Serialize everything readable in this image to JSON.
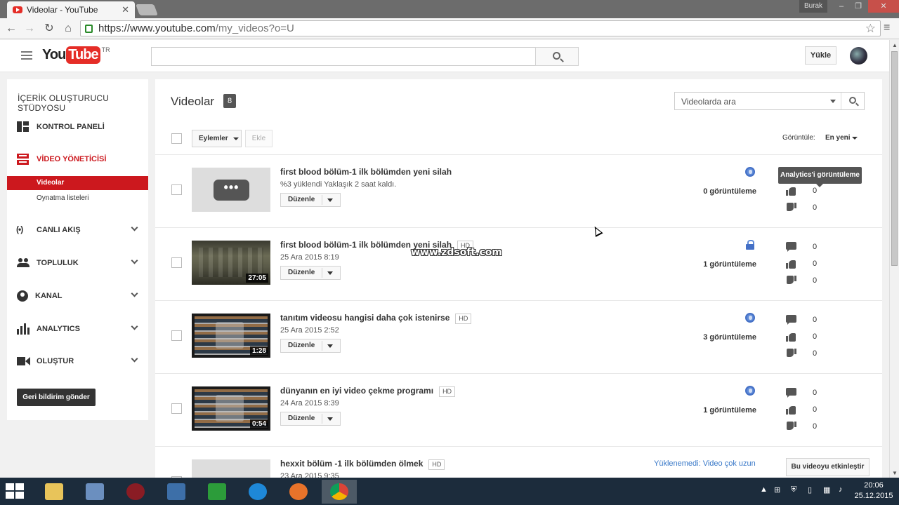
{
  "browser": {
    "tab_title": "Videolar - YouTube",
    "user": "Burak",
    "url_host": "https://www.youtube.com",
    "url_path": "/my_videos?o=U"
  },
  "header": {
    "logo_you": "You",
    "logo_tube": "Tube",
    "region": "TR",
    "upload_label": "Yükle"
  },
  "sidebar": {
    "title": "İÇERİK OLUŞTURUCU STÜDYOSU",
    "items": [
      {
        "label": "KONTROL PANELİ",
        "icon": "dashboard-icon"
      },
      {
        "label": "VİDEO YÖNETİCİSİ",
        "icon": "video-manager-icon"
      },
      {
        "label": "CANLI AKIŞ",
        "icon": "live-icon"
      },
      {
        "label": "TOPLULUK",
        "icon": "community-icon"
      },
      {
        "label": "KANAL",
        "icon": "channel-icon"
      },
      {
        "label": "ANALYTICS",
        "icon": "analytics-icon"
      },
      {
        "label": "OLUŞTUR",
        "icon": "create-icon"
      }
    ],
    "subitems": [
      {
        "label": "Videolar",
        "active": true
      },
      {
        "label": "Oynatma listeleri",
        "active": false
      }
    ],
    "feedback_label": "Geri bildirim gönder"
  },
  "main": {
    "title": "Videolar",
    "count": "8",
    "search_placeholder": "Videolarda ara",
    "actions_label": "Eylemler",
    "add_label": "Ekle",
    "sort_label": "Görüntüle:",
    "sort_value": "En yeni",
    "edit_label": "Düzenle",
    "tooltip": "Analytics'i görüntüleme",
    "videos": [
      {
        "title": "first blood bölüm-1 ilk bölümden yeni silah",
        "hd": "",
        "meta": "%3 yüklendi Yaklaşık 2 saat kaldı.",
        "duration": "",
        "privacy": "public",
        "views": "0 görüntüleme",
        "comments": "",
        "likes": "0",
        "dislikes": "0"
      },
      {
        "title": "first blood bölüm-1 ilk bölümden yeni silah",
        "hd": "HD",
        "meta": "25 Ara 2015 8:19",
        "duration": "27:05",
        "privacy": "private",
        "views": "1 görüntüleme",
        "comments": "0",
        "likes": "0",
        "dislikes": "0"
      },
      {
        "title": "tanıtım videosu hangisi daha çok istenirse",
        "hd": "HD",
        "meta": "25 Ara 2015 2:52",
        "duration": "1:28",
        "privacy": "public",
        "views": "3 görüntüleme",
        "comments": "0",
        "likes": "0",
        "dislikes": "0"
      },
      {
        "title": "dünyanın en iyi video çekme programı",
        "hd": "HD",
        "meta": "24 Ara 2015 8:39",
        "duration": "0:54",
        "privacy": "public",
        "views": "1 görüntüleme",
        "comments": "0",
        "likes": "0",
        "dislikes": "0"
      },
      {
        "title": "hexxit bölüm -1 ilk bölümden ölmek",
        "hd": "HD",
        "meta": "23 Ara 2015 9:35",
        "status": "Yüklenemedi: Video çok uzun",
        "activate_label": "Bu videoyu etkinleştir"
      }
    ]
  },
  "watermark": "www.zdsoft.com",
  "taskbar": {
    "time": "20:06",
    "date": "25.12.2015"
  }
}
